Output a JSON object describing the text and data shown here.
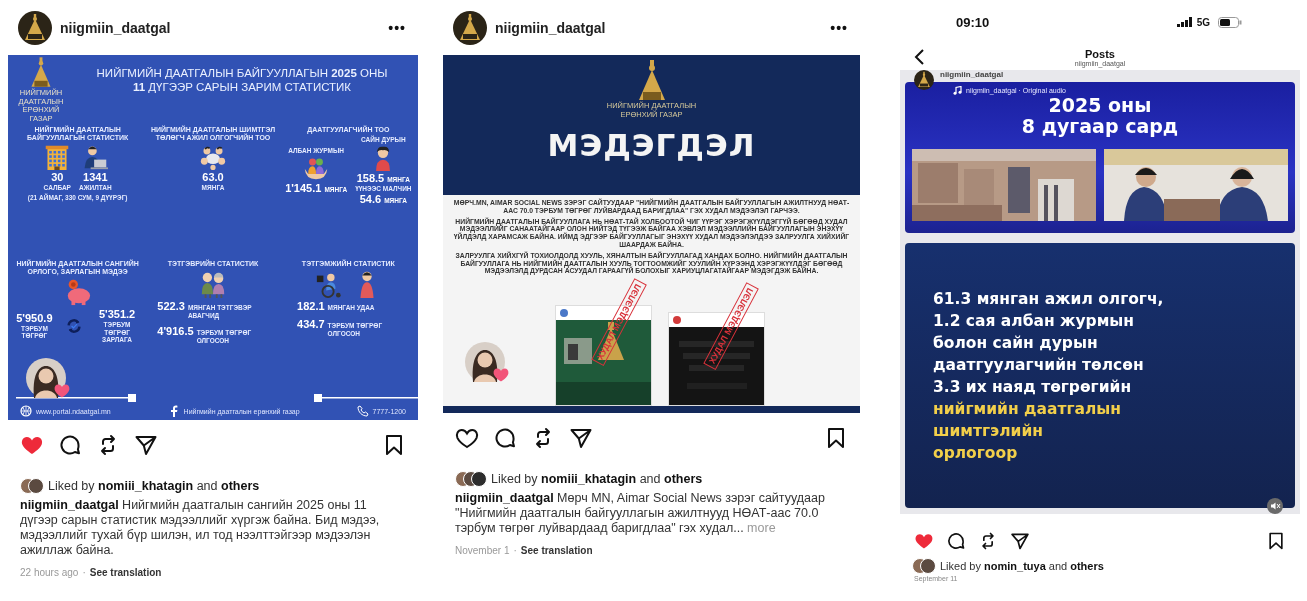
{
  "posts": [
    {
      "kind": "infographic",
      "username": "niigmiin_daatgal",
      "more": "•••",
      "liked": true,
      "liked_by": "Liked by **nomiii_khatagin** and **others**",
      "caption": "**niigmiin_daatgal** Нийгмийн даатгалын сангийн 2025 оны 11 дүгээр сарын статистик мэдээллийг хүргэж байна. Бид мэдээ, мэдээллийг тухай бүр шилэн, ил тод нээлттэйгээр мэдээлэн ажиллаж байна.",
      "time": "22 hours ago",
      "separator": "·",
      "translate": "See translation",
      "infographic": {
        "logo_caption": "НИЙГМИЙН ДААТГАЛЫН ЕРӨНХИЙ ГАЗАР",
        "title": [
          "НИЙГМИЙН ДААТГАЛЫН БАЙГУУЛЛАГЫН **2025** ОНЫ",
          "**11** ДҮГЭЭР САРЫН ЗАРИМ СТАТИСТИК"
        ],
        "sections": [
          {
            "heading": "НИЙГМИЙН ДААТГАЛЫН БАЙГУУЛЛАГЫН СТАТИСТИК",
            "stats": [
              {
                "value": "30",
                "label": "САЛБАР"
              },
              {
                "value": "1341",
                "label": "АЖИЛТАН"
              }
            ],
            "note": "(21 АЙМАГ, 330 СУМ, 9 ДҮҮРЭГ)"
          },
          {
            "heading": "НИЙГМИЙН ДААТГАЛЫН ШИМТГЭЛ ТӨЛӨГЧ АЖИЛ ОЛГОГЧИЙН ТОО",
            "stats": [
              {
                "value": "63.0",
                "label": "МЯНГА"
              }
            ]
          },
          {
            "heading": "ДААТГУУЛАГЧИЙН ТОО",
            "stats": [
              {
                "label_top": "АЛБАН ЖУРМЫН",
                "value": "1'145.1",
                "unit": "МЯНГА"
              },
              {
                "label_top": "САЙН ДУРЫН",
                "value": "158.5",
                "unit": "МЯНГА",
                "sub_label": "ҮҮНЭЭС МАЛЧИН",
                "sub_value": "54.6",
                "sub_unit": "МЯНГА"
              }
            ]
          },
          {
            "heading": "НИЙГМИЙН ДААТГАЛЫН САНГИЙН ОРЛОГО, ЗАРЛАГЫН МЭДЭЭ",
            "stats": [
              {
                "value": "5'950.9",
                "label": "ТЭРБУМ ТӨГРӨГ"
              },
              {
                "value": "5'351.2",
                "label": "ТЭРБУМ ТӨГРӨГ ЗАРЛАГА"
              }
            ]
          },
          {
            "heading": "ТЭТГЭВРИЙН СТАТИСТИК",
            "stats": [
              {
                "value": "522.3",
                "label": "МЯНГАН ТЭТГЭВЭР АВАГЧИД"
              },
              {
                "value": "4'916.5",
                "label": "ТЭРБУМ ТӨГРӨГ ОЛГОСОН"
              }
            ]
          },
          {
            "heading": "ТЭТГЭМЖИЙН СТАТИСТИК",
            "stats": [
              {
                "value": "182.1",
                "label": "МЯНГАН УДАА"
              },
              {
                "value": "434.7",
                "label": "ТЭРБУМ ТӨГРӨГ ОЛГОСОН"
              }
            ]
          }
        ],
        "footer": [
          "www.portal.ndaatgal.mn",
          "Нийгмийн даатгалын ерөнхий газар",
          "7777-1200"
        ]
      }
    },
    {
      "kind": "notice",
      "username": "niigmiin_daatgal",
      "more": "•••",
      "liked": false,
      "liked_by": "Liked by **nomiii_khatagin** and **others**",
      "caption": "**niigmiin_daatgal** Мөрч MN, Aimar Social News зэрэг сайтуудаар \"Нийгмийн даатгалын байгууллагын ажилтнууд НӨАТ-аас 70.0 тэрбум төгрөг луйвардаад баригдлаа\" гэх худал...",
      "caption_more": "more",
      "time": "November 1",
      "separator": "·",
      "translate": "See translation",
      "notice": {
        "logo_caption": "НИЙГМИЙН ДААТГАЛЫН ЕРӨНХИЙ ГАЗАР",
        "heading": "МЭДЭГДЭЛ",
        "paragraphs": [
          "МӨРЧ.MN, AIMAR SOCIAL NEWS ЗЭРЭГ САЙТУУДААР \"НИЙГМИЙН ДААТГАЛЫН БАЙГУУЛЛАГЫН АЖИЛТНУУД НӨАТ-ААС 70.0 ТЭРБУМ ТӨГРӨГ ЛУЙВАРДААД БАРИГДЛАА\" ГЭХ ХУДАЛ МЭДЭЭЛЭЛ ГАРЧЭЭ.",
          "НИЙГМИЙН ДААТГАЛЫН БАЙГУУЛЛАГА НЬ НӨАТ-ТАЙ ХОЛБООТОЙ ЧИГ ҮҮРЭГ ХЭРЭГЖҮҮЛДЭГГҮЙ БӨГӨӨД ХУДАЛ МЭДЭЭЛЛИЙГ САНААТАЙГААР ОЛОН НИЙТЭД ТҮГЭЭЖ БАЙГАА ХЭВЛЭЛ МЭДЭЭЛЛИЙН БАЙГУУЛЛАГЫН ЭНЭХҮҮ ҮЙЛДЭЛД ХАРАМСАЖ БАЙНА. ИЙМД ЭДГЭЭР БАЙГУУЛЛАГЫГ ЭНЭХҮҮ ХУДАЛ МЭДЭЭЛЭЛДЭЭ ЗАЛРУУЛГА ХИЙХИЙГ ШААРДАЖ БАЙНА.",
          "ЗАЛРУУЛГА ХИЙХГҮЙ ТОХИОЛДОЛД ХУУЛЬ, ХЯНАЛТЫН БАЙГУУЛЛАГАД ХАНДАХ БОЛНО. НИЙГМИЙН ДААТГАЛЫН БАЙГУУЛЛАГА НЬ НИЙГМИЙН ДААТГАЛЫН ХУУЛЬ ТОГТООМЖИЙГ ХУУЛИЙН ХҮРЭЭНД ХЭРЭГЖҮҮЛДЭГ БӨГӨӨД МЭДЭЭЛЭЛД ДУРДСАН АСУУДАЛ ГАРААГҮЙ БОЛОХЫГ ХАРИУЦЛАГАТАЙГААР МЭДЭГДЭЖ БАЙНА."
        ],
        "stamps": [
          "ХУДАЛ МЭДЭЭЛЭЛ",
          "ХУДАЛ МЭДЭЭЛЭЛ"
        ]
      }
    }
  ],
  "phone": {
    "time": "09:10",
    "network": "5G",
    "title": "Posts",
    "subtitle": "niigmiin_daatgal",
    "username": "niigmiin_daatgal",
    "audio": "niigmiin_daatgal · Original audio",
    "card_heading": [
      "2025 оны",
      "8 дугаар сард"
    ],
    "card_lines": [
      {
        "text": "61.3 мянган ажил олгогч,",
        "highlight": false
      },
      {
        "text": "1.2 сая албан журмын",
        "highlight": false
      },
      {
        "text": "болон сайн дурын",
        "highlight": false
      },
      {
        "text": "даатгуулагчийн төлсөн",
        "highlight": false
      },
      {
        "text": "3.3 их наяд төгрөгийн",
        "highlight": false
      },
      {
        "text": "нийгмийн даатгалын",
        "highlight": true
      },
      {
        "text": "шимтгэлийн",
        "highlight": true
      },
      {
        "text": "орлогоор",
        "highlight": true
      }
    ],
    "liked": true,
    "liked_by": "Liked by **nomin_tuya** and **others**",
    "date": "September 11"
  }
}
